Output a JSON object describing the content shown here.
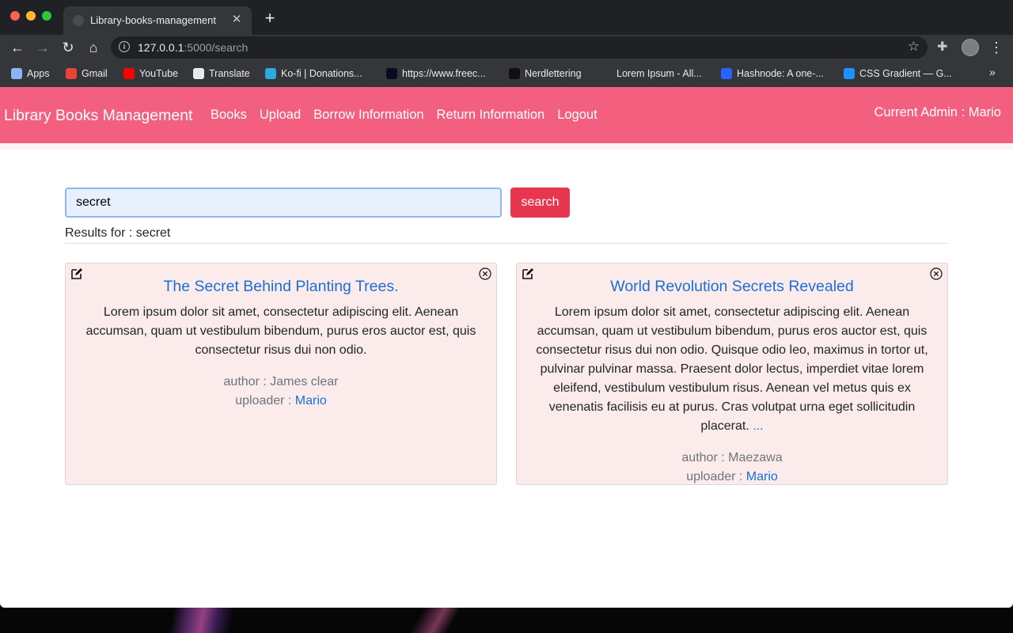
{
  "browser": {
    "tab_title": "Library-books-management",
    "url_host": "127.0.0.1",
    "url_rest": ":5000/search",
    "bookmarks": [
      {
        "label": "Apps",
        "icon": "apps-grid-icon",
        "color": "#8ab4f8"
      },
      {
        "label": "Gmail",
        "icon": "gmail-icon",
        "color": "#ea4335"
      },
      {
        "label": "YouTube",
        "icon": "youtube-icon",
        "color": "#ff0000"
      },
      {
        "label": "Translate",
        "icon": "translate-icon",
        "color": "#e8eaed"
      },
      {
        "label": "Ko-fi | Donations...",
        "icon": "kofi-icon",
        "color": "#29abe0"
      },
      {
        "label": "https://www.freec...",
        "icon": "freecodecamp-icon",
        "color": "#0a0a23"
      },
      {
        "label": "Nerdlettering",
        "icon": "nerdlettering-icon",
        "color": "#111111"
      },
      {
        "label": "Lorem Ipsum - All...",
        "icon": "lorem-ipsum-icon",
        "color": "#35363a"
      },
      {
        "label": "Hashnode: A one-...",
        "icon": "hashnode-icon",
        "color": "#2962ff"
      },
      {
        "label": "CSS Gradient — G...",
        "icon": "css-gradient-icon",
        "color": "#1e90ff"
      }
    ]
  },
  "navbar": {
    "brand": "Library Books Management",
    "links": [
      "Books",
      "Upload",
      "Borrow Information",
      "Return Information",
      "Logout"
    ],
    "admin_label": "Current Admin : Mario",
    "color": "#f3607f"
  },
  "search": {
    "value": "secret",
    "button_label": "search",
    "results_label": "Results for : secret"
  },
  "books": [
    {
      "title": "The Secret Behind Planting Trees.",
      "description": "Lorem ipsum dolor sit amet, consectetur adipiscing elit. Aenean accumsan, quam ut vestibulum bibendum, purus eros auctor est, quis consectetur risus dui non odio.",
      "more": "",
      "author_label": "author : James clear",
      "uploader_prefix": "uploader : ",
      "uploader": "Mario"
    },
    {
      "title": "World Revolution Secrets Revealed",
      "description": "Lorem ipsum dolor sit amet, consectetur adipiscing elit. Aenean accumsan, quam ut vestibulum bibendum, purus eros auctor est, quis consectetur risus dui non odio. Quisque odio leo, maximus in tortor ut, pulvinar pulvinar massa. Praesent dolor lectus, imperdiet vitae lorem eleifend, vestibulum vestibulum risus. Aenean vel metus quis ex venenatis facilisis eu at purus. Cras volutpat urna eget sollicitudin placerat.",
      "more": "...",
      "author_label": "author : Maezawa",
      "uploader_prefix": "uploader : ",
      "uploader": "Mario"
    }
  ]
}
